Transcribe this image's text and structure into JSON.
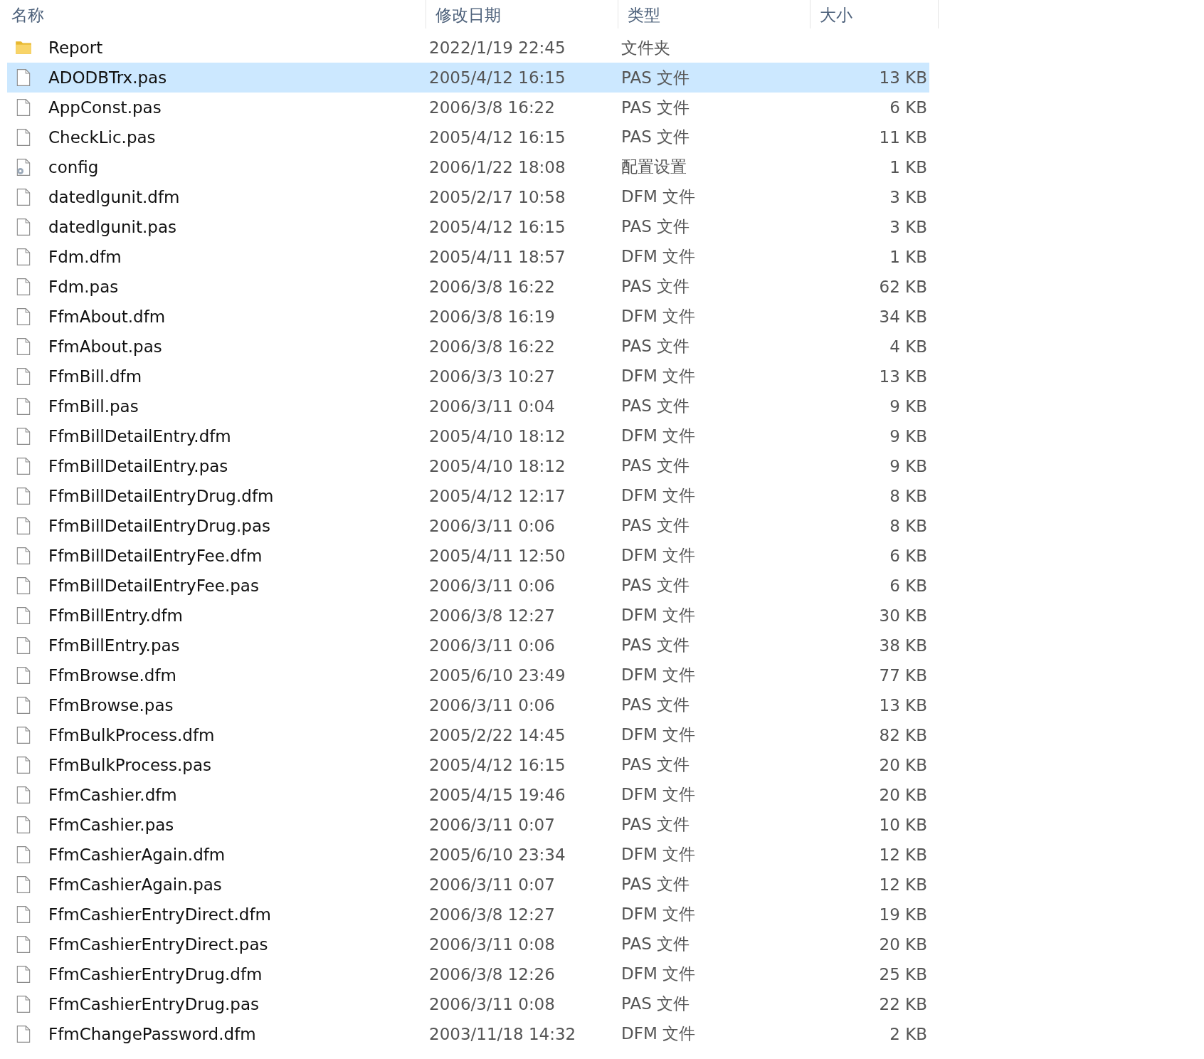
{
  "columns": [
    "名称",
    "修改日期",
    "类型",
    "大小"
  ],
  "rows": [
    {
      "kind": "folder",
      "name": "Report",
      "date": "2022/1/19 22:45",
      "type": "文件夹",
      "size": "",
      "selected": false
    },
    {
      "kind": "file",
      "name": "ADODBTrx.pas",
      "date": "2005/4/12 16:15",
      "type": "PAS 文件",
      "size": "13 KB",
      "selected": true
    },
    {
      "kind": "file",
      "name": "AppConst.pas",
      "date": "2006/3/8 16:22",
      "type": "PAS 文件",
      "size": "6 KB",
      "selected": false
    },
    {
      "kind": "file",
      "name": "CheckLic.pas",
      "date": "2005/4/12 16:15",
      "type": "PAS 文件",
      "size": "11 KB",
      "selected": false
    },
    {
      "kind": "config",
      "name": "config",
      "date": "2006/1/22 18:08",
      "type": "配置设置",
      "size": "1 KB",
      "selected": false
    },
    {
      "kind": "file",
      "name": "datedlgunit.dfm",
      "date": "2005/2/17 10:58",
      "type": "DFM 文件",
      "size": "3 KB",
      "selected": false
    },
    {
      "kind": "file",
      "name": "datedlgunit.pas",
      "date": "2005/4/12 16:15",
      "type": "PAS 文件",
      "size": "3 KB",
      "selected": false
    },
    {
      "kind": "file",
      "name": "Fdm.dfm",
      "date": "2005/4/11 18:57",
      "type": "DFM 文件",
      "size": "1 KB",
      "selected": false
    },
    {
      "kind": "file",
      "name": "Fdm.pas",
      "date": "2006/3/8 16:22",
      "type": "PAS 文件",
      "size": "62 KB",
      "selected": false
    },
    {
      "kind": "file",
      "name": "FfmAbout.dfm",
      "date": "2006/3/8 16:19",
      "type": "DFM 文件",
      "size": "34 KB",
      "selected": false
    },
    {
      "kind": "file",
      "name": "FfmAbout.pas",
      "date": "2006/3/8 16:22",
      "type": "PAS 文件",
      "size": "4 KB",
      "selected": false
    },
    {
      "kind": "file",
      "name": "FfmBill.dfm",
      "date": "2006/3/3 10:27",
      "type": "DFM 文件",
      "size": "13 KB",
      "selected": false
    },
    {
      "kind": "file",
      "name": "FfmBill.pas",
      "date": "2006/3/11 0:04",
      "type": "PAS 文件",
      "size": "9 KB",
      "selected": false
    },
    {
      "kind": "file",
      "name": "FfmBillDetailEntry.dfm",
      "date": "2005/4/10 18:12",
      "type": "DFM 文件",
      "size": "9 KB",
      "selected": false
    },
    {
      "kind": "file",
      "name": "FfmBillDetailEntry.pas",
      "date": "2005/4/10 18:12",
      "type": "PAS 文件",
      "size": "9 KB",
      "selected": false
    },
    {
      "kind": "file",
      "name": "FfmBillDetailEntryDrug.dfm",
      "date": "2005/4/12 12:17",
      "type": "DFM 文件",
      "size": "8 KB",
      "selected": false
    },
    {
      "kind": "file",
      "name": "FfmBillDetailEntryDrug.pas",
      "date": "2006/3/11 0:06",
      "type": "PAS 文件",
      "size": "8 KB",
      "selected": false
    },
    {
      "kind": "file",
      "name": "FfmBillDetailEntryFee.dfm",
      "date": "2005/4/11 12:50",
      "type": "DFM 文件",
      "size": "6 KB",
      "selected": false
    },
    {
      "kind": "file",
      "name": "FfmBillDetailEntryFee.pas",
      "date": "2006/3/11 0:06",
      "type": "PAS 文件",
      "size": "6 KB",
      "selected": false
    },
    {
      "kind": "file",
      "name": "FfmBillEntry.dfm",
      "date": "2006/3/8 12:27",
      "type": "DFM 文件",
      "size": "30 KB",
      "selected": false
    },
    {
      "kind": "file",
      "name": "FfmBillEntry.pas",
      "date": "2006/3/11 0:06",
      "type": "PAS 文件",
      "size": "38 KB",
      "selected": false
    },
    {
      "kind": "file",
      "name": "FfmBrowse.dfm",
      "date": "2005/6/10 23:49",
      "type": "DFM 文件",
      "size": "77 KB",
      "selected": false
    },
    {
      "kind": "file",
      "name": "FfmBrowse.pas",
      "date": "2006/3/11 0:06",
      "type": "PAS 文件",
      "size": "13 KB",
      "selected": false
    },
    {
      "kind": "file",
      "name": "FfmBulkProcess.dfm",
      "date": "2005/2/22 14:45",
      "type": "DFM 文件",
      "size": "82 KB",
      "selected": false
    },
    {
      "kind": "file",
      "name": "FfmBulkProcess.pas",
      "date": "2005/4/12 16:15",
      "type": "PAS 文件",
      "size": "20 KB",
      "selected": false
    },
    {
      "kind": "file",
      "name": "FfmCashier.dfm",
      "date": "2005/4/15 19:46",
      "type": "DFM 文件",
      "size": "20 KB",
      "selected": false
    },
    {
      "kind": "file",
      "name": "FfmCashier.pas",
      "date": "2006/3/11 0:07",
      "type": "PAS 文件",
      "size": "10 KB",
      "selected": false
    },
    {
      "kind": "file",
      "name": "FfmCashierAgain.dfm",
      "date": "2005/6/10 23:34",
      "type": "DFM 文件",
      "size": "12 KB",
      "selected": false
    },
    {
      "kind": "file",
      "name": "FfmCashierAgain.pas",
      "date": "2006/3/11 0:07",
      "type": "PAS 文件",
      "size": "12 KB",
      "selected": false
    },
    {
      "kind": "file",
      "name": "FfmCashierEntryDirect.dfm",
      "date": "2006/3/8 12:27",
      "type": "DFM 文件",
      "size": "19 KB",
      "selected": false
    },
    {
      "kind": "file",
      "name": "FfmCashierEntryDirect.pas",
      "date": "2006/3/11 0:08",
      "type": "PAS 文件",
      "size": "20 KB",
      "selected": false
    },
    {
      "kind": "file",
      "name": "FfmCashierEntryDrug.dfm",
      "date": "2006/3/8 12:26",
      "type": "DFM 文件",
      "size": "25 KB",
      "selected": false
    },
    {
      "kind": "file",
      "name": "FfmCashierEntryDrug.pas",
      "date": "2006/3/11 0:08",
      "type": "PAS 文件",
      "size": "22 KB",
      "selected": false
    },
    {
      "kind": "file",
      "name": "FfmChangePassword.dfm",
      "date": "2003/11/18 14:32",
      "type": "DFM 文件",
      "size": "2 KB",
      "selected": false
    }
  ]
}
